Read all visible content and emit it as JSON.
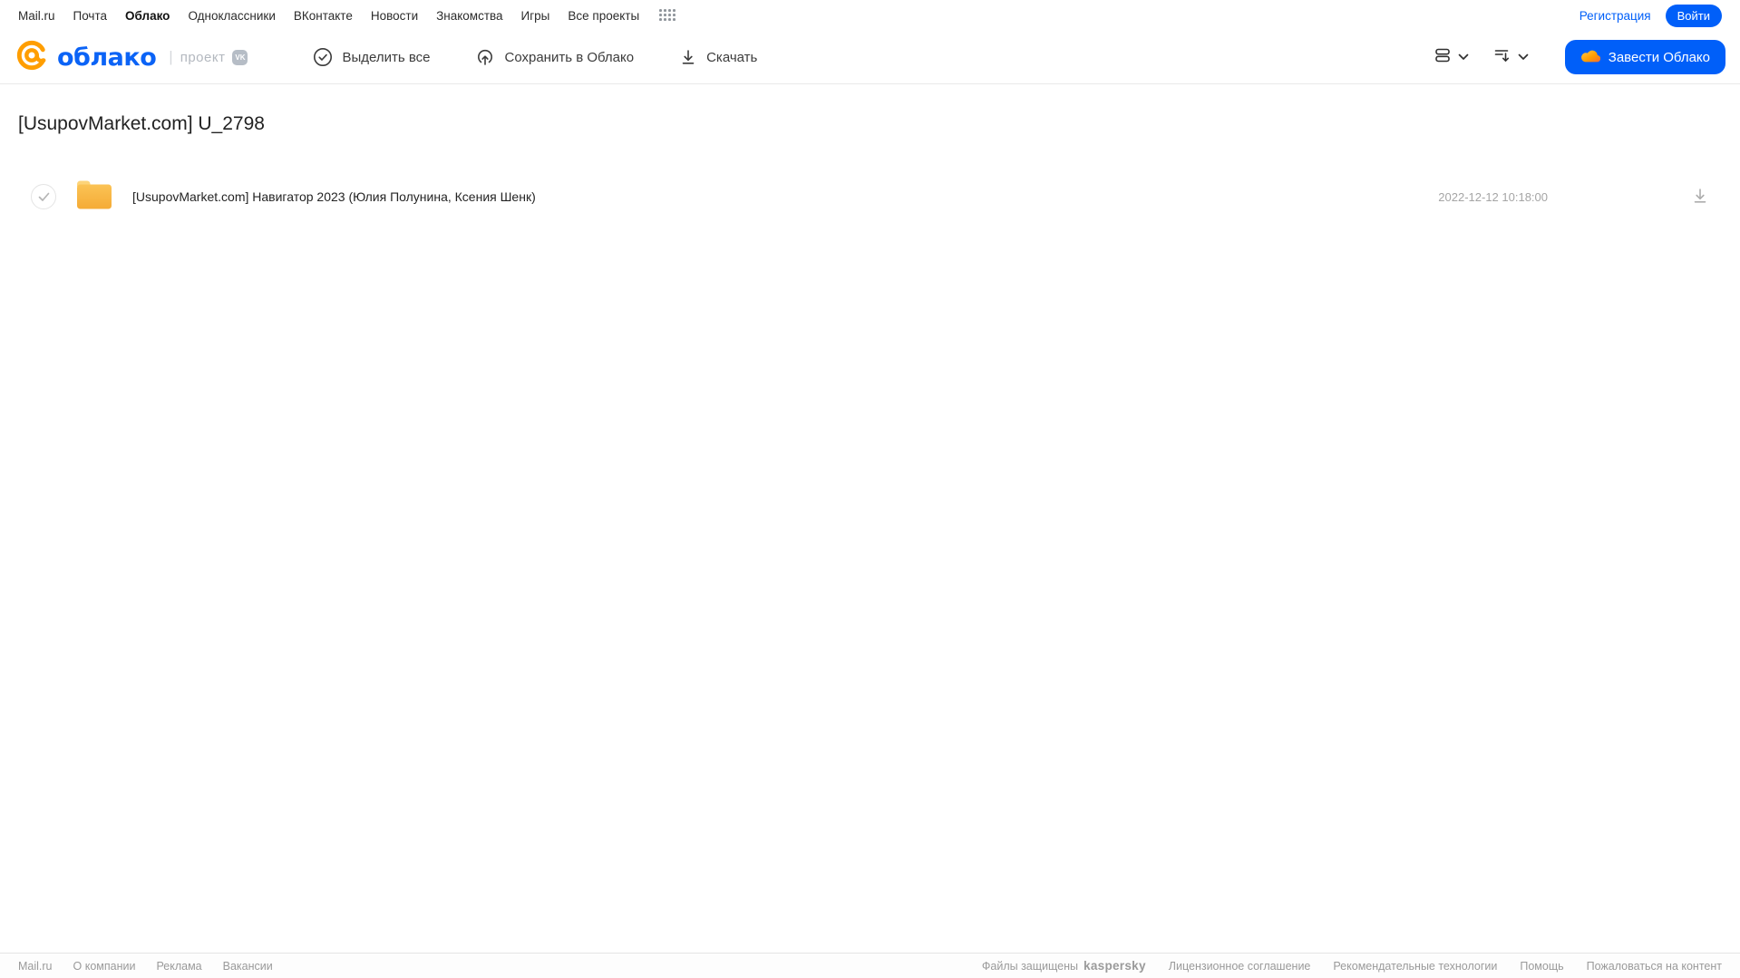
{
  "colors": {
    "accent_blue": "#005ff9",
    "logo_orange": "#ff9e00",
    "folder_yellow": "#f9b942",
    "kaspersky_teal": "#00a88e",
    "muted_gray": "#a5a5a5"
  },
  "top_nav": {
    "links": [
      "Mail.ru",
      "Почта",
      "Облако",
      "Одноклассники",
      "ВКонтакте",
      "Новости",
      "Знакомства",
      "Игры",
      "Все проекты"
    ],
    "active_link": "Облако",
    "register_label": "Регистрация",
    "login_label": "Войти"
  },
  "header": {
    "logo_text": "облако",
    "project_separator": "|",
    "project_label": "проект",
    "vk_badge_label": "VK",
    "select_all_label": "Выделить все",
    "save_to_cloud_label": "Сохранить в Облако",
    "download_label": "Скачать",
    "get_cloud_label": "Завести Облако"
  },
  "main": {
    "title": "[UsupovMarket.com] U_2798",
    "files": [
      {
        "type": "folder",
        "name": "[UsupovMarket.com] Навигатор 2023 (Юлия Полунина, Ксения Шенк)",
        "modified": "2022-12-12 10:18:00"
      }
    ]
  },
  "footer": {
    "links_left": [
      "Mail.ru",
      "О компании",
      "Реклама",
      "Вакансии"
    ],
    "protected_label": "Файлы защищены",
    "kaspersky_label": "kaspersky",
    "links_right": [
      "Лицензионное соглашение",
      "Рекомендательные технологии",
      "Помощь",
      "Пожаловаться на контент"
    ]
  },
  "icons": {
    "apps-grid-icon": "4x3 dot grid",
    "at-logo-icon": "orange @ mark",
    "vk-badge-icon": "VK rounded square",
    "check-circle-icon": "circled checkmark",
    "cloud-upload-icon": "cloud with up arrow",
    "download-icon": "down arrow over line",
    "view-mode-icon": "stacked rows",
    "sort-icon": "lines with down arrow",
    "chevron-down-icon": "v chevron",
    "cloud-icon": "orange cloud",
    "folder-icon": "yellow folder"
  }
}
